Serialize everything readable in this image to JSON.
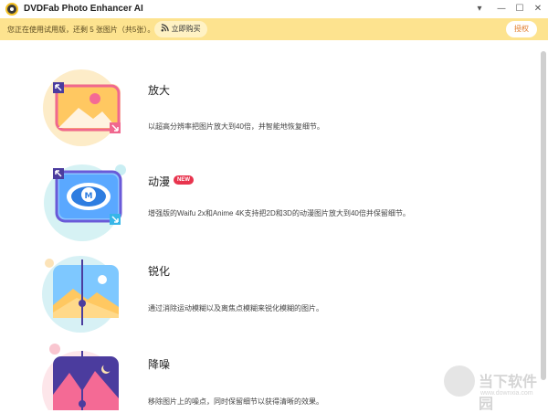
{
  "window": {
    "title": "DVDFab Photo Enhancer AI"
  },
  "titlebar": {
    "menu_icon": "▾",
    "minimize_icon": "—",
    "maximize_icon": "☐",
    "close_icon": "✕"
  },
  "trial": {
    "notice": "您正在使用试用版，还剩 5 张图片（共5张）。",
    "buy_label": "立即购买",
    "authorize_label": "授权"
  },
  "features": [
    {
      "title": "放大",
      "description": "以超高分辨率把图片放大到40倍，并智能地恢复细节。",
      "badge": ""
    },
    {
      "title": "动漫",
      "description": "增强版的Waifu 2x和Anime 4K支持把2D和3D的动漫图片放大到40倍并保留细节。",
      "badge": "NEW"
    },
    {
      "title": "锐化",
      "description": "通过消除运动模糊以及离焦点模糊来锐化模糊的图片。",
      "badge": ""
    },
    {
      "title": "降噪",
      "description": "移除图片上的噪点，同时保留细节以获得清晰的效果。",
      "badge": ""
    }
  ],
  "watermark": {
    "main": "当下软件园",
    "sub": "www.downxia.com"
  },
  "colors": {
    "trial_bar": "#fde38f",
    "accent_pink": "#e8344e",
    "auth_text": "#e07a2a"
  }
}
